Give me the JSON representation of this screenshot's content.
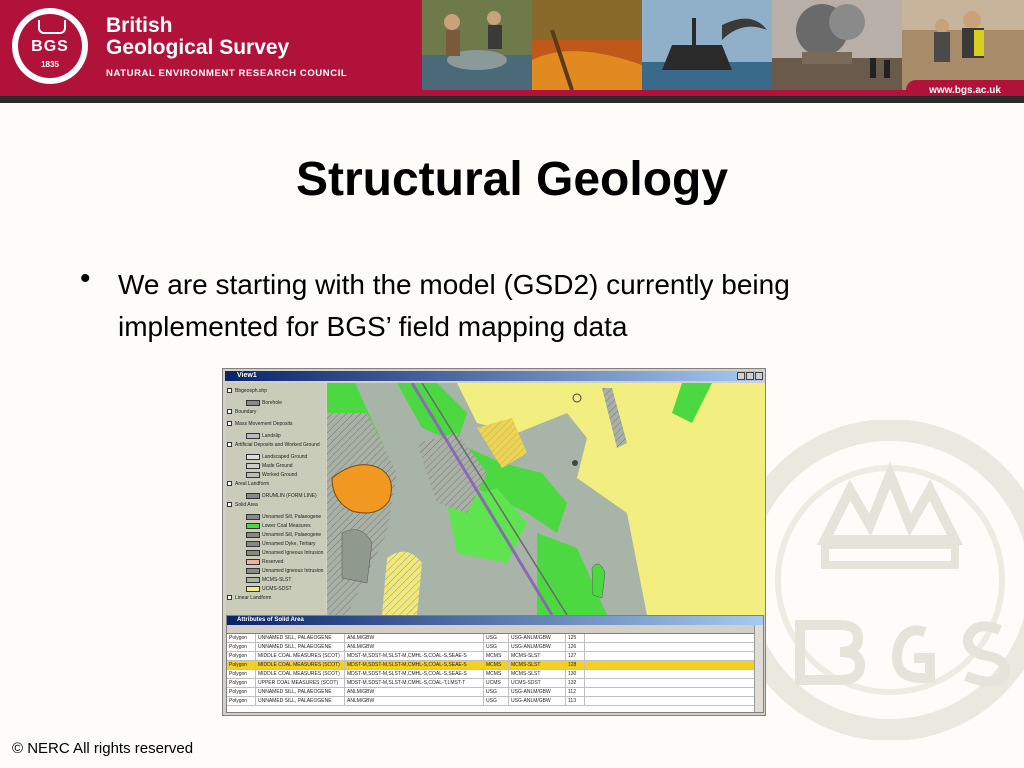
{
  "header": {
    "logo_text": "BGS",
    "logo_year": "1835",
    "org_line1": "British",
    "org_line2": "Geological Survey",
    "org_sub": "NATURAL ENVIRONMENT RESEARCH COUNCIL",
    "url": "www.bgs.ac.uk",
    "brand_color": "#b0123a"
  },
  "slide": {
    "title": "Structural Geology",
    "bullet_symbol": "•",
    "bullet_text": "We are starting with the model (GSD2) currently being implemented for BGS’ field mapping data"
  },
  "gis_window": {
    "title": "View1",
    "legend": [
      {
        "label": "Bbgeosph.shp",
        "checked": true
      },
      {
        "label": "Borehole",
        "checked": false
      },
      {
        "label": "Boundary",
        "checked": true
      },
      {
        "label": "Mass Movement Deposits",
        "checked": true
      },
      {
        "label": "Landslip",
        "checked": false
      },
      {
        "label": "Artificial Deposits and Worked Ground",
        "checked": true
      },
      {
        "label": "Landscaped Ground",
        "checked": false
      },
      {
        "label": "Made Ground",
        "checked": false
      },
      {
        "label": "Worked Ground",
        "checked": false
      },
      {
        "label": "Areal Landform",
        "checked": true
      },
      {
        "label": "DRUMLIN (FORM LINE)",
        "checked": false
      },
      {
        "label": "Solid Area",
        "checked": true
      },
      {
        "label": "Unnamed Sill, Palaeogene",
        "checked": false
      },
      {
        "label": "Lower Coal Measures",
        "checked": false
      },
      {
        "label": "Unnamed Sill, Palaeogene",
        "checked": false
      },
      {
        "label": "Unnamed Dyke, Tertiary",
        "checked": false
      },
      {
        "label": "Unnamed Igneous Intrusion",
        "checked": false
      },
      {
        "label": "Reserved",
        "checked": false
      },
      {
        "label": "Unnamed Igneous Intrusion",
        "checked": false
      },
      {
        "label": "MCMS-SLST",
        "checked": false
      },
      {
        "label": "UCMS-SDST",
        "checked": false
      },
      {
        "label": "Linear Landform",
        "checked": true
      }
    ],
    "attributes": {
      "title": "Attributes of Solid Area",
      "rows": [
        {
          "shape": "Polygon",
          "lexicon": "UNNAMED SILL, PALAEOGENE",
          "rocks": "ANLM/GBW",
          "code": "USG",
          "desc": "USG-ANLM/GBW",
          "id": "125",
          "selected": false
        },
        {
          "shape": "Polygon",
          "lexicon": "UNNAMED SILL, PALAEOGENE",
          "rocks": "ANLM/GBW",
          "code": "USG",
          "desc": "USG-ANLM/GBW",
          "id": "126",
          "selected": false
        },
        {
          "shape": "Polygon",
          "lexicon": "MIDDLE COAL MEASURES (SCOT)",
          "rocks": "MDST-M,SDST-M,SLST-M,CMHL-S,COAL-S,SEAE-S",
          "code": "MCMS",
          "desc": "MCMS-SLST",
          "id": "127",
          "selected": false
        },
        {
          "shape": "Polygon",
          "lexicon": "MIDDLE COAL MEASURES (SCOT)",
          "rocks": "MDST-M,SDST-M,SLST-M,CMHL-S,COAL-S,SEAE-S",
          "code": "MCMS",
          "desc": "MCMS-SLST",
          "id": "128",
          "selected": true
        },
        {
          "shape": "Polygon",
          "lexicon": "MIDDLE COAL MEASURES (SCOT)",
          "rocks": "MDST-M,SDST-M,SLST-M,CMHL-S,COAL-S,SEAE-S",
          "code": "MCMS",
          "desc": "MCMS-SLST",
          "id": "130",
          "selected": false
        },
        {
          "shape": "Polygon",
          "lexicon": "UPPER COAL MEASURES (SCOT)",
          "rocks": "MDST-M,SDST-M,SLST-M,CMHL-S,COAL-T,LMST-T",
          "code": "UCMS",
          "desc": "UCMS-SDST",
          "id": "132",
          "selected": false
        },
        {
          "shape": "Polygon",
          "lexicon": "UNNAMED SILL, PALAEOGENE",
          "rocks": "ANLM/GBW",
          "code": "USG",
          "desc": "USG-ANLM/GBW",
          "id": "112",
          "selected": false
        },
        {
          "shape": "Polygon",
          "lexicon": "UNNAMED SILL, PALAEOGENE",
          "rocks": "ANLM/GBW",
          "code": "USG",
          "desc": "USG-ANLM/GBW",
          "id": "113",
          "selected": false
        }
      ]
    }
  },
  "footer": {
    "copyright": "© NERC All rights reserved"
  }
}
